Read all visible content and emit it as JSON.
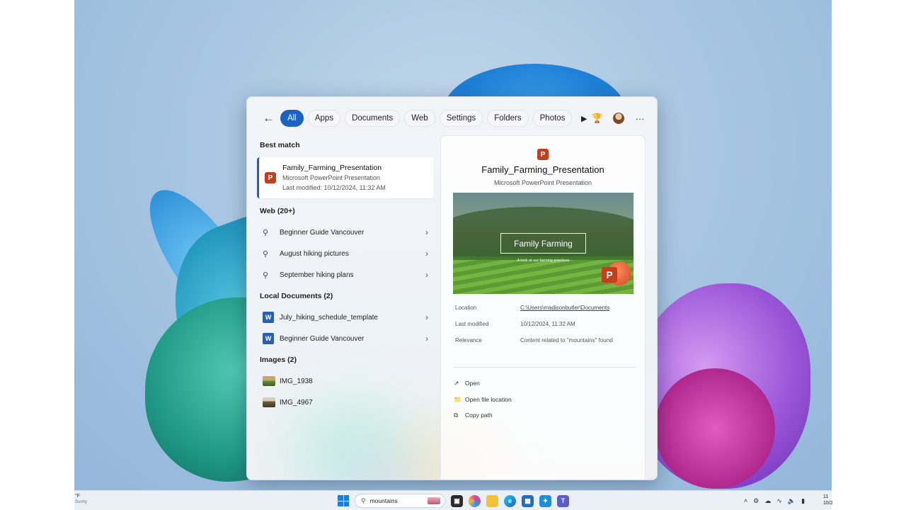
{
  "search_panel": {
    "filters": [
      "All",
      "Apps",
      "Documents",
      "Web",
      "Settings",
      "Folders",
      "Photos"
    ],
    "best_match": {
      "heading": "Best match",
      "title": "Family_Farming_Presentation",
      "type": "Microsoft PowerPoint Presentation",
      "modified": "Last modified: 10/12/2024, 11:32 AM"
    },
    "web": {
      "heading": "Web (20+)",
      "items": [
        "Beginner Guide Vancouver",
        "August hiking pictures",
        "September hiking plans"
      ]
    },
    "local_documents": {
      "heading": "Local Documents (2)",
      "items": [
        "July_hiking_schedule_template",
        "Beginner Guide Vancouver"
      ]
    },
    "images": {
      "heading": "Images (2)",
      "items": [
        "IMG_1938",
        "IMG_4967"
      ]
    },
    "preview": {
      "title": "Family_Farming_Presentation",
      "subtitle": "Microsoft PowerPoint Presentation",
      "slide_title": "Family Farming",
      "slide_caption": "A look at our farming practices",
      "details": [
        {
          "label": "Location",
          "value": "C:\\Users\\madisonbutler\\Documents"
        },
        {
          "label": "Last modified",
          "value": "10/12/2024, 11:32 AM"
        },
        {
          "label": "Relevance",
          "value": "Content related to \"mountains\" found"
        }
      ],
      "actions": [
        "Open",
        "Open file location",
        "Copy path"
      ]
    }
  },
  "taskbar": {
    "weather_temp": "°F",
    "weather_desc": "Sunny",
    "search_text": "mountains",
    "clock_time": "11",
    "clock_date": "10/2"
  },
  "colors": {
    "accent": "#1a63c2",
    "powerpoint": "#c43e1c",
    "word": "#2b5fb4"
  }
}
